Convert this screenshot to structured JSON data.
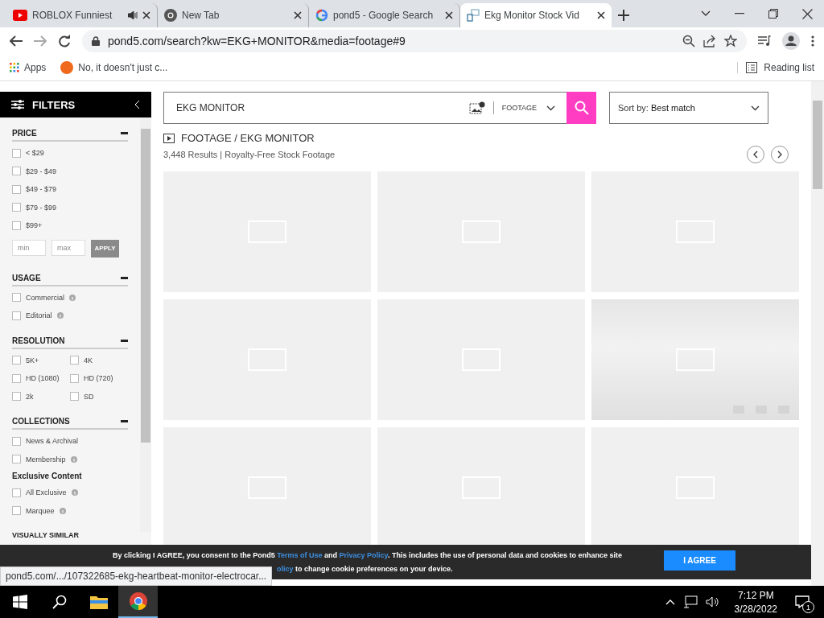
{
  "browser": {
    "tabs": [
      {
        "title": "ROBLOX Funniest",
        "audio": true,
        "selected": false
      },
      {
        "title": "New Tab",
        "audio": false,
        "selected": false
      },
      {
        "title": "pond5 - Google Search",
        "audio": false,
        "selected": false
      },
      {
        "title": "Ekg Monitor Stock Vid",
        "audio": false,
        "selected": true
      }
    ],
    "url": "pond5.com/search?kw=EKG+MONITOR&media=footage#9",
    "bookmarks": [
      {
        "label": "Apps"
      },
      {
        "label": "No, it doesn't just c..."
      }
    ],
    "reading_list": "Reading list"
  },
  "sidebar": {
    "title": "FILTERS",
    "sections": [
      {
        "title": "PRICE",
        "kind": "list",
        "items": [
          {
            "kind": "check",
            "label": "< $29",
            "checked": false,
            "info": false
          },
          {
            "kind": "check",
            "label": "$29 - $49",
            "checked": false,
            "info": false
          },
          {
            "kind": "check",
            "label": "$49 - $79",
            "checked": false,
            "info": false
          },
          {
            "kind": "check",
            "label": "$79 - $99",
            "checked": false,
            "info": false
          },
          {
            "kind": "check",
            "label": "$99+",
            "checked": false,
            "info": false
          },
          {
            "kind": "range",
            "min_placeholder": "min",
            "max_placeholder": "max",
            "button": "APPLY",
            "disabled": true
          }
        ]
      },
      {
        "title": "USAGE",
        "kind": "list",
        "items": [
          {
            "kind": "check",
            "label": "Commercial",
            "checked": false,
            "info": true
          },
          {
            "kind": "check",
            "label": "Editorial",
            "checked": false,
            "info": true
          }
        ]
      },
      {
        "title": "RESOLUTION",
        "kind": "two_column",
        "items": [
          {
            "kind": "check",
            "label": "5K+",
            "checked": false,
            "info": false
          },
          {
            "kind": "check",
            "label": "4K",
            "checked": false,
            "info": false
          },
          {
            "kind": "check",
            "label": "HD (1080)",
            "checked": false,
            "info": false
          },
          {
            "kind": "check",
            "label": "HD (720)",
            "checked": false,
            "info": false
          },
          {
            "kind": "check",
            "label": "2k",
            "checked": false,
            "info": false
          },
          {
            "kind": "check",
            "label": "SD",
            "checked": false,
            "info": false
          }
        ]
      },
      {
        "title": "COLLECTIONS",
        "kind": "list",
        "items": [
          {
            "kind": "check",
            "label": "News & Archival",
            "checked": false,
            "info": false
          },
          {
            "kind": "check",
            "label": "Membership",
            "checked": false,
            "info": true
          },
          {
            "kind": "subheading",
            "label": "Exclusive Content"
          },
          {
            "kind": "check",
            "label": "All Exclusive",
            "checked": false,
            "info": true
          },
          {
            "kind": "check",
            "label": "Marquee",
            "checked": false,
            "info": true
          }
        ]
      }
    ],
    "collapsed_section": "VISUALLY SIMILAR"
  },
  "search": {
    "query": "EKG MONITOR",
    "media": "FOOTAGE",
    "sort_label": "Sort by:",
    "sort_value": "Best match"
  },
  "breadcrumb": {
    "media": "FOOTAGE",
    "query": " / EKG MONITOR"
  },
  "results": "3,448 Results | Royalty-Free Stock Footage",
  "thumbnails": [
    {
      "kind": "placeholder"
    },
    {
      "kind": "placeholder"
    },
    {
      "kind": "placeholder"
    },
    {
      "kind": "placeholder"
    },
    {
      "kind": "placeholder"
    },
    {
      "kind": "preview"
    },
    {
      "kind": "placeholder"
    },
    {
      "kind": "placeholder"
    },
    {
      "kind": "placeholder"
    }
  ],
  "cookie_banner": {
    "line_1": [
      {
        "kind": "text",
        "text": "By clicking I AGREE, you consent to the Pond5 "
      },
      {
        "kind": "link",
        "text": "Terms of Use"
      },
      {
        "kind": "text",
        "text": " and "
      },
      {
        "kind": "link",
        "text": "Privacy Policy"
      },
      {
        "kind": "text",
        "text": ". This includes the use of personal data and cookies to enhance site"
      }
    ],
    "line_2": [
      {
        "kind": "link",
        "text": "olicy"
      },
      {
        "kind": "text",
        "text": " to change cookie preferences on your device."
      }
    ],
    "button": "I AGREE"
  },
  "status_url": "pond5.com/.../107322685-ekg-heartbeat-monitor-electrocar...",
  "taskbar": {
    "time": "7:12 PM",
    "date": "3/28/2022",
    "notifications": "1"
  }
}
